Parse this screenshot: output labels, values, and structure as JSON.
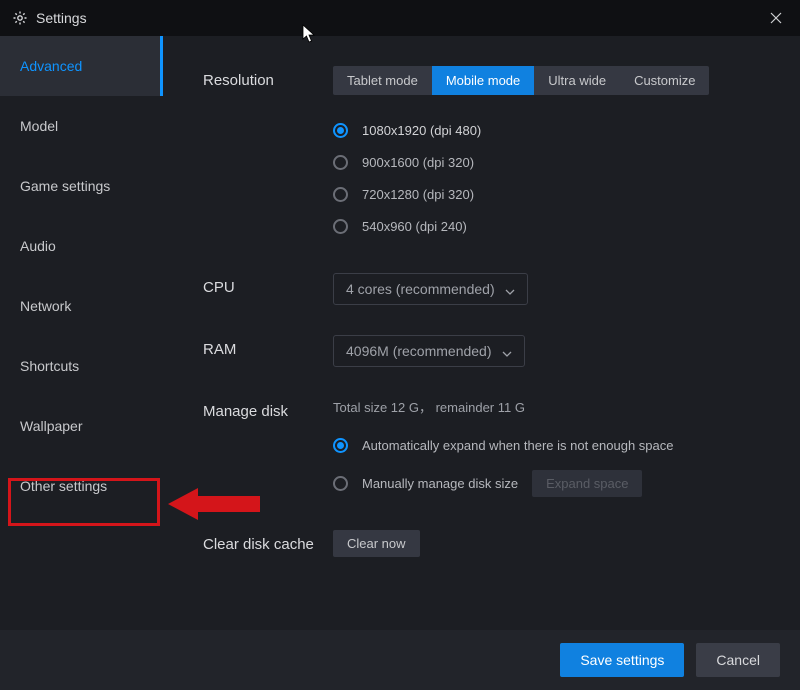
{
  "window": {
    "title": "Settings"
  },
  "sidebar": {
    "items": [
      {
        "label": "Advanced",
        "active": true
      },
      {
        "label": "Model",
        "active": false
      },
      {
        "label": "Game settings",
        "active": false
      },
      {
        "label": "Audio",
        "active": false
      },
      {
        "label": "Network",
        "active": false
      },
      {
        "label": "Shortcuts",
        "active": false
      },
      {
        "label": "Wallpaper",
        "active": false
      },
      {
        "label": "Other settings",
        "active": false
      }
    ]
  },
  "resolution": {
    "label": "Resolution",
    "tabs": [
      {
        "label": "Tablet mode",
        "selected": false
      },
      {
        "label": "Mobile mode",
        "selected": true
      },
      {
        "label": "Ultra wide",
        "selected": false
      },
      {
        "label": "Customize",
        "selected": false
      }
    ],
    "options": [
      {
        "label": "1080x1920  (dpi 480)",
        "checked": true
      },
      {
        "label": "900x1600  (dpi 320)",
        "checked": false
      },
      {
        "label": "720x1280  (dpi 320)",
        "checked": false
      },
      {
        "label": "540x960  (dpi 240)",
        "checked": false
      }
    ]
  },
  "cpu": {
    "label": "CPU",
    "value": "4 cores (recommended)"
  },
  "ram": {
    "label": "RAM",
    "value": "4096M (recommended)"
  },
  "disk": {
    "label": "Manage disk",
    "info": "Total size 12 G， remainder 11 G",
    "auto_label": "Automatically expand when there is not enough space",
    "manual_label": "Manually manage disk size",
    "expand_btn": "Expand space",
    "auto_checked": true
  },
  "cache": {
    "label": "Clear disk cache",
    "btn": "Clear now"
  },
  "footer": {
    "save": "Save settings",
    "cancel": "Cancel"
  }
}
